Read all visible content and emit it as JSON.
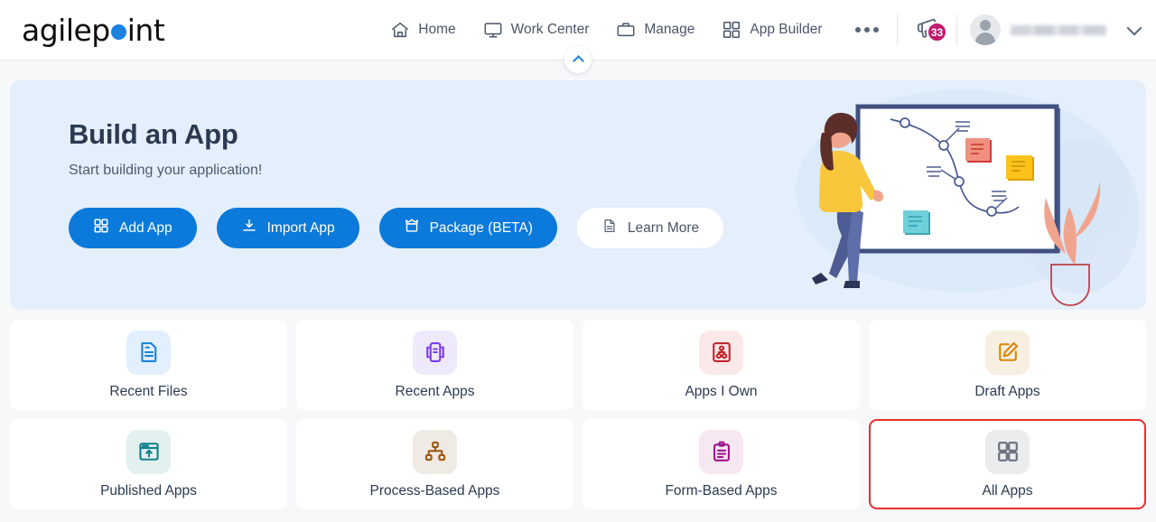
{
  "header": {
    "logo_text_1": "agilep",
    "logo_dot": "o",
    "logo_text_2": "int",
    "nav": [
      {
        "label": "Home",
        "icon": "home-icon"
      },
      {
        "label": "Work Center",
        "icon": "monitor-icon"
      },
      {
        "label": "Manage",
        "icon": "briefcase-icon"
      },
      {
        "label": "App Builder",
        "icon": "grid-icon"
      }
    ],
    "more_label": "More",
    "notification": {
      "icon": "megaphone-icon",
      "count": "33",
      "badge_color": "#c2186e"
    },
    "user": {
      "name": "",
      "avatar_icon": "user-avatar-icon",
      "caret_icon": "chevron-down-icon"
    },
    "collapse_icon": "chevron-up-icon"
  },
  "hero": {
    "title": "Build an App",
    "subtitle": "Start building your application!",
    "accent_color": "#0b7ada",
    "background_color": "#e4effb",
    "buttons": [
      {
        "label": "Add App",
        "icon": "grid-icon",
        "style": "primary"
      },
      {
        "label": "Import App",
        "icon": "download-icon",
        "style": "primary"
      },
      {
        "label": "Package (BETA)",
        "icon": "package-icon",
        "style": "primary"
      },
      {
        "label": "Learn More",
        "icon": "document-icon",
        "style": "light"
      }
    ],
    "illustration": "woman-drawing-flowchart-on-whiteboard"
  },
  "tiles": [
    {
      "label": "Recent Files",
      "icon": "file-document-icon",
      "icon_color": "#1a81e0",
      "icon_bg": "#e2f0fd",
      "highlighted": false
    },
    {
      "label": "Recent Apps",
      "icon": "app-window-icon",
      "icon_color": "#7c3ced",
      "icon_bg": "#eee9fb",
      "highlighted": false
    },
    {
      "label": "Apps I Own",
      "icon": "org-chart-icon",
      "icon_color": "#c1272d",
      "icon_bg": "#fbe9ea",
      "highlighted": false
    },
    {
      "label": "Draft Apps",
      "icon": "edit-pencil-icon",
      "icon_color": "#d9860b",
      "icon_bg": "#f7efdf",
      "highlighted": false
    },
    {
      "label": "Published Apps",
      "icon": "publish-upload-icon",
      "icon_color": "#13808c",
      "icon_bg": "#e3f0f0",
      "highlighted": false
    },
    {
      "label": "Process-Based Apps",
      "icon": "hierarchy-icon",
      "icon_color": "#9c5a14",
      "icon_bg": "#efeae3",
      "highlighted": false
    },
    {
      "label": "Form-Based Apps",
      "icon": "clipboard-form-icon",
      "icon_color": "#a0148c",
      "icon_bg": "#f6e7f3",
      "highlighted": false
    },
    {
      "label": "All Apps",
      "icon": "grid-squares-icon",
      "icon_color": "#6b7280",
      "icon_bg": "#ebecee",
      "highlighted": true
    }
  ]
}
